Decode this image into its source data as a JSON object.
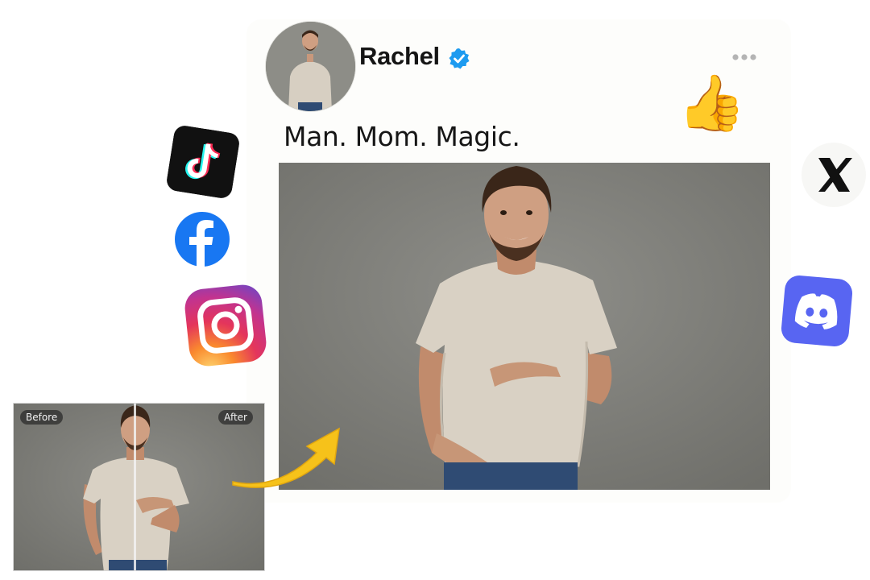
{
  "post": {
    "username": "Rachel",
    "caption": "Man. Mom. Magic."
  },
  "compare": {
    "before_label": "Before",
    "after_label": "After"
  },
  "reaction": {
    "emoji": "👍"
  },
  "colors": {
    "verified_blue": "#1d9bf0",
    "discord_blurple": "#5865f2",
    "facebook_blue": "#1877f2",
    "arrow_yellow": "#f6c21a",
    "backdrop_gray": "#858580",
    "tshirt_beige": "#d9d1c4",
    "jeans_blue": "#2f4b73"
  },
  "icons": [
    "tiktok-logo-icon",
    "facebook-logo-icon",
    "instagram-logo-icon",
    "x-logo-icon",
    "discord-logo-icon",
    "verified-badge-icon",
    "more-options-icon",
    "thumbs-up-icon",
    "curved-arrow-icon"
  ]
}
